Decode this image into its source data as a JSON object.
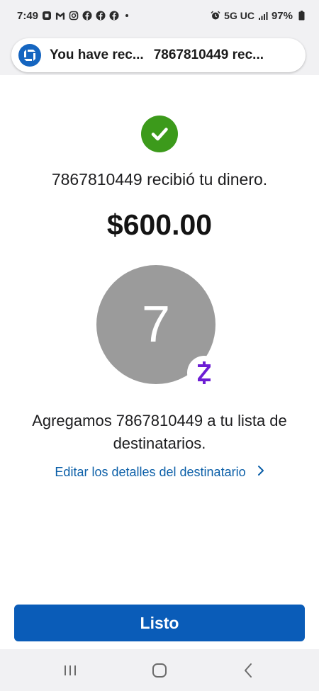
{
  "status_bar": {
    "time": "7:49",
    "network": "5G UC",
    "battery": "97%",
    "notification_icons": [
      "chase-icon",
      "gmail-icon",
      "instagram-icon",
      "facebook-icon",
      "facebook-icon",
      "facebook-icon"
    ]
  },
  "notification": {
    "title": "You have rec...",
    "message": "7867810449 rec...",
    "logo_color": "#1565c0"
  },
  "confirmation": {
    "message": "7867810449 recibió tu dinero.",
    "amount": "$600.00",
    "check_color": "#3c9a1b"
  },
  "recipient": {
    "initial": "7",
    "avatar_color": "#9b9b9b",
    "badge_icon": "zelle-icon",
    "badge_color": "#6d1ed4"
  },
  "added_message": "Agregamos 7867810449 a tu lista de destinatarios.",
  "edit_link": {
    "label": "Editar los detalles del destinatario",
    "color": "#0b5fa8"
  },
  "done_button": {
    "label": "Listo",
    "color": "#0a5cb8"
  },
  "nav": {
    "recents": "recents-icon",
    "home": "home-icon",
    "back": "back-icon"
  }
}
